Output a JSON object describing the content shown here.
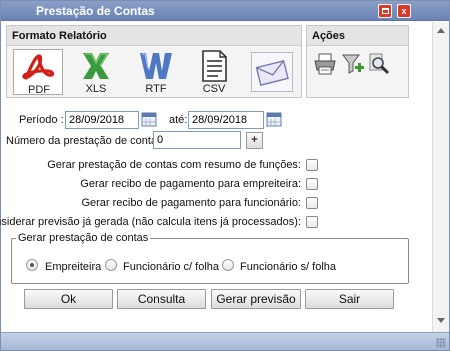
{
  "window": {
    "title": "Prestação de Contas",
    "close_glyph": "x",
    "title_color": "#ffffff",
    "titlebar_color": "#7b92bf"
  },
  "formato": {
    "heading": "Formato Relatório",
    "items": [
      {
        "label": "PDF",
        "icon": "pdf-icon",
        "selected": true
      },
      {
        "label": "XLS",
        "icon": "excel-icon",
        "selected": false
      },
      {
        "label": "RTF",
        "icon": "word-icon",
        "selected": false
      },
      {
        "label": "CSV",
        "icon": "csv-document-icon",
        "selected": false
      },
      {
        "label": "",
        "icon": "email-envelope-icon",
        "selected": false
      }
    ]
  },
  "acoes": {
    "heading": "Ações",
    "items": [
      {
        "icon": "printer-icon"
      },
      {
        "icon": "add-filter-icon"
      },
      {
        "icon": "search-preview-icon"
      }
    ]
  },
  "periodo": {
    "label": "Período :",
    "start": "28/09/2018",
    "until_label": "até:",
    "end": "28/09/2018"
  },
  "numero": {
    "label": "Número da prestação de contas:",
    "value": "0",
    "plus_label": "+"
  },
  "options": [
    {
      "label": "Gerar prestação de contas com resumo de funções:",
      "checked": false
    },
    {
      "label": "Gerar recibo de pagamento para empreiteira:",
      "checked": false
    },
    {
      "label": "Gerar recibo de pagamento para funcionário:",
      "checked": false
    },
    {
      "label": "Considerar previsão já gerada (não calcula itens já processados):",
      "checked": false
    }
  ],
  "gerar": {
    "legend": "Gerar prestação de contas",
    "options": [
      {
        "label": "Empreiteira",
        "selected": true
      },
      {
        "label": "Funcionário c/ folha",
        "selected": false
      },
      {
        "label": "Funcionário s/ folha",
        "selected": false
      }
    ]
  },
  "buttons": {
    "ok": "Ok",
    "consulta": "Consulta",
    "gerar_previsao": "Gerar previsão",
    "sair": "Sair"
  }
}
